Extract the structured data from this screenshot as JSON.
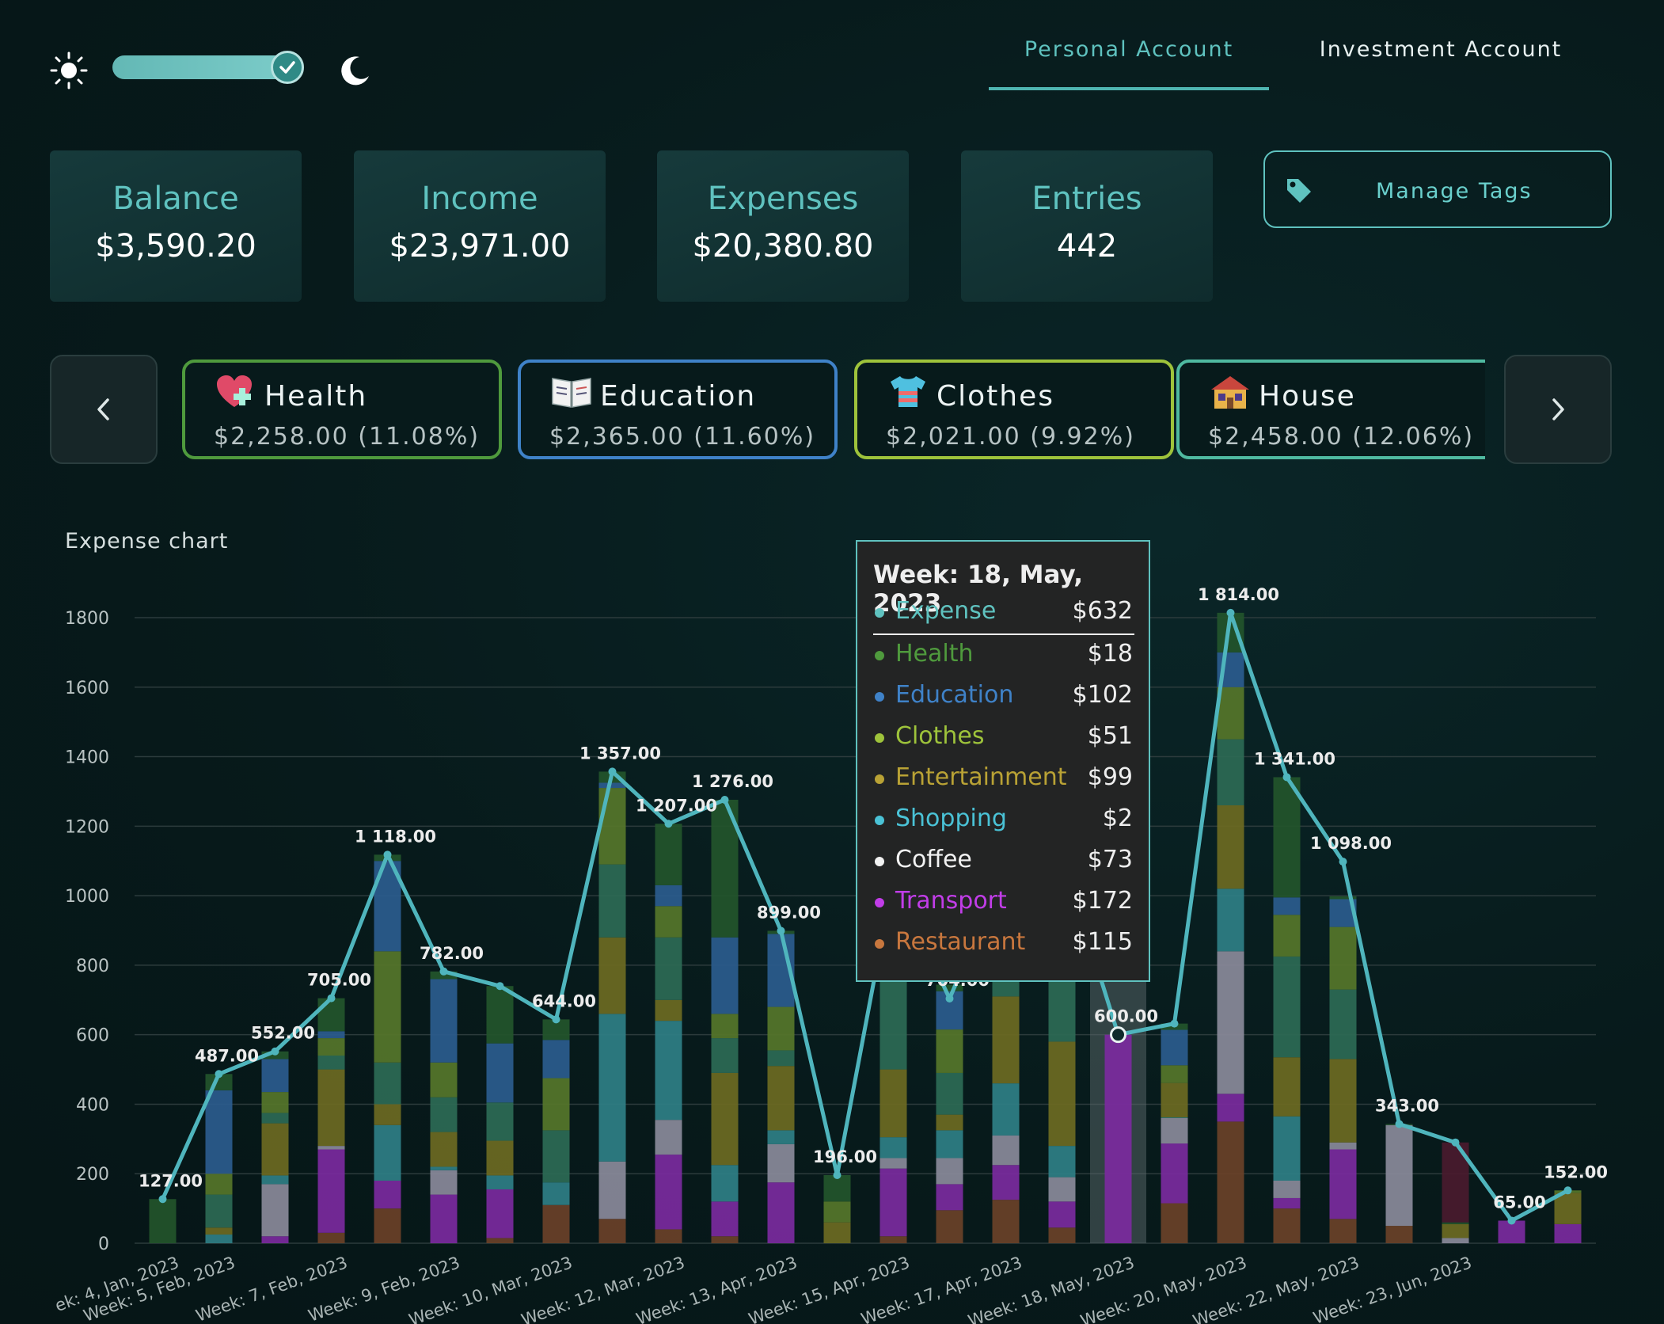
{
  "theme": {
    "mode": "dark"
  },
  "tabs": [
    {
      "label": "Personal Account",
      "active": true
    },
    {
      "label": "Investment Account",
      "active": false
    }
  ],
  "stats": [
    {
      "label": "Balance",
      "value": "$3,590.20"
    },
    {
      "label": "Income",
      "value": "$23,971.00"
    },
    {
      "label": "Expenses",
      "value": "$20,380.80"
    },
    {
      "label": "Entries",
      "value": "442"
    }
  ],
  "manage_tags": {
    "label": "Manage Tags",
    "icon": "tag-icon"
  },
  "categories": [
    {
      "name": "Health",
      "amount": "$2,258.00",
      "percent": "(11.08%)",
      "color": "#4f9a3d",
      "icon": "heart-plus-icon"
    },
    {
      "name": "Education",
      "amount": "$2,365.00",
      "percent": "(11.60%)",
      "color": "#3f82c8",
      "icon": "open-book-icon"
    },
    {
      "name": "Clothes",
      "amount": "$2,021.00",
      "percent": "(9.92%)",
      "color": "#9ec33b",
      "icon": "tshirt-icon"
    },
    {
      "name": "House",
      "amount": "$2,458.00",
      "percent": "(12.06%)",
      "color": "#4fb9a0",
      "icon": "house-icon"
    }
  ],
  "chart": {
    "title": "Expense chart"
  },
  "chart_data": {
    "type": "bar",
    "stacked": true,
    "overlay_line": "Expense",
    "ylim": [
      0,
      1800
    ],
    "yticks": [
      0,
      200,
      400,
      600,
      800,
      1000,
      1200,
      1400,
      1600,
      1800
    ],
    "grid": true,
    "categories": [
      "Week: 4, Jan, 2023",
      "Week: 5, Feb, 2023",
      "",
      "Week: 7, Feb, 2023",
      "",
      "Week: 9, Feb, 2023",
      "",
      "Week: 10, Mar, 2023",
      "",
      "Week: 12, Mar, 2023",
      "",
      "Week: 13, Apr, 2023",
      "",
      "Week: 15, Apr, 2023",
      "",
      "Week: 17, Apr, 2023",
      "",
      "Week: 18, May, 2023",
      "",
      "Week: 20, May, 2023",
      "",
      "Week: 22, May, 2023",
      "",
      "Week: 23, Jun, 2023",
      "",
      ""
    ],
    "category_labels": [
      "ek: 4, Jan, 2023",
      "Week: 5, Feb, 2023",
      "Week: 7, Feb, 2023",
      "Week: 9, Feb, 2023",
      "Week: 10, Mar, 2023",
      "Week: 12, Mar, 2023",
      "Week: 13, Apr, 2023",
      "Week: 15, Apr, 2023",
      "Week: 17, Apr, 2023",
      "Week: 18, May, 2023",
      "Week: 20, May, 2023",
      "Week: 22, May, 2023",
      "Week: 23, Jun, 2023"
    ],
    "expense_totals": [
      127,
      487,
      552,
      705,
      1118,
      782,
      740,
      644,
      1357,
      1207,
      1276,
      899,
      196,
      1050,
      704,
      1080,
      1120,
      600,
      632,
      1814,
      1341,
      1098,
      343,
      290,
      65,
      152
    ],
    "point_labels": [
      "127.00",
      "487.00",
      "552.00",
      "705.00",
      "1 118.00",
      "782.00",
      "",
      "644.00",
      "1 357.00",
      "1 207.00",
      "1 276.00",
      "899.00",
      "196.00",
      "",
      "704.00",
      "",
      "",
      "600.00",
      "",
      "1 814.00",
      "1 341.00",
      "1 098.00",
      "343.00",
      "",
      "65.00",
      "152.00"
    ],
    "series": [
      {
        "name": "Restaurant",
        "color": "#6a4128",
        "values": [
          0,
          0,
          0,
          30,
          100,
          0,
          15,
          110,
          70,
          40,
          20,
          0,
          0,
          20,
          95,
          125,
          45,
          0,
          115,
          350,
          100,
          70,
          50,
          0,
          0,
          0
        ]
      },
      {
        "name": "Transport",
        "color": "#7b2a9e",
        "values": [
          0,
          0,
          20,
          240,
          80,
          140,
          140,
          0,
          0,
          215,
          100,
          175,
          0,
          195,
          75,
          100,
          75,
          600,
          172,
          80,
          30,
          200,
          0,
          0,
          65,
          55
        ]
      },
      {
        "name": "Coffee",
        "color": "#8a8a9a",
        "values": [
          0,
          0,
          150,
          10,
          0,
          70,
          0,
          0,
          165,
          100,
          0,
          110,
          0,
          30,
          75,
          85,
          70,
          0,
          73,
          410,
          50,
          20,
          290,
          15,
          0,
          0
        ]
      },
      {
        "name": "Shopping",
        "color": "#2f7f86",
        "values": [
          0,
          25,
          25,
          0,
          160,
          10,
          40,
          65,
          425,
          285,
          105,
          40,
          0,
          60,
          80,
          150,
          90,
          0,
          2,
          180,
          185,
          0,
          0,
          0,
          0,
          0
        ]
      },
      {
        "name": "Entertainment",
        "color": "#6d6a22",
        "values": [
          0,
          20,
          150,
          220,
          60,
          100,
          100,
          0,
          220,
          60,
          265,
          185,
          60,
          195,
          45,
          250,
          300,
          0,
          99,
          240,
          170,
          240,
          0,
          40,
          0,
          90
        ]
      },
      {
        "name": "House",
        "color": "#2d6a55",
        "values": [
          0,
          95,
          30,
          40,
          120,
          100,
          110,
          150,
          210,
          180,
          100,
          45,
          0,
          310,
          120,
          50,
          200,
          0,
          0,
          190,
          290,
          200,
          0,
          0,
          0,
          0
        ]
      },
      {
        "name": "Clothes",
        "color": "#56762a",
        "values": [
          0,
          60,
          60,
          50,
          320,
          100,
          0,
          150,
          220,
          90,
          70,
          125,
          60,
          140,
          125,
          150,
          40,
          0,
          51,
          150,
          120,
          180,
          0,
          0,
          0,
          7
        ]
      },
      {
        "name": "Education",
        "color": "#2b5c8e",
        "values": [
          0,
          240,
          95,
          20,
          260,
          240,
          170,
          110,
          15,
          60,
          220,
          210,
          0,
          110,
          110,
          80,
          200,
          0,
          102,
          100,
          50,
          80,
          0,
          0,
          0,
          0
        ]
      },
      {
        "name": "Health",
        "color": "#23552b",
        "values": [
          127,
          47,
          22,
          95,
          18,
          22,
          165,
          59,
          32,
          177,
          396,
          9,
          76,
          0,
          19,
          0,
          0,
          0,
          18,
          114,
          346,
          8,
          3,
          5,
          0,
          0
        ]
      },
      {
        "name": "Other",
        "color": "#4a1a2e",
        "values": [
          0,
          0,
          0,
          0,
          0,
          0,
          0,
          0,
          0,
          0,
          0,
          0,
          0,
          0,
          0,
          0,
          0,
          0,
          0,
          0,
          0,
          0,
          0,
          230,
          0,
          0
        ]
      }
    ]
  },
  "tooltip": {
    "title": "Week: 18, May, 2023",
    "expense": {
      "name": "Expense",
      "value": "$632",
      "color": "#5fc2bf"
    },
    "rows": [
      {
        "name": "Health",
        "value": "$18",
        "color": "#4f9a3d"
      },
      {
        "name": "Education",
        "value": "$102",
        "color": "#3f82c8"
      },
      {
        "name": "Clothes",
        "value": "$51",
        "color": "#9ec33b"
      },
      {
        "name": "Entertainment",
        "value": "$99",
        "color": "#b9a235"
      },
      {
        "name": "Shopping",
        "value": "$2",
        "color": "#4ac2d6"
      },
      {
        "name": "Coffee",
        "value": "$73",
        "color": "#f2f2f2"
      },
      {
        "name": "Transport",
        "value": "$172",
        "color": "#c13de8"
      },
      {
        "name": "Restaurant",
        "value": "$115",
        "color": "#c8773e"
      }
    ]
  }
}
